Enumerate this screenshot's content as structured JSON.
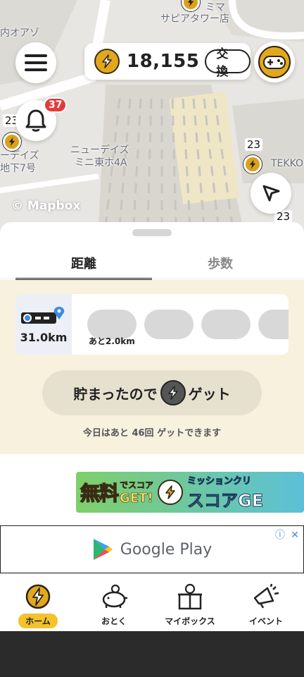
{
  "map": {
    "labels": {
      "mima": "ミマ",
      "sapia": "サピアタワー店",
      "uchioazo": "内オアゾ",
      "newdays1": "ニューデイズ",
      "newdays2": "ミニ東ホ4A",
      "fides": "ーデイズ",
      "chika7": "地下7号",
      "tekko": "TEKKO",
      "num23a": "23",
      "num23b": "23",
      "num23c": "23"
    },
    "attribution": "© Mapbox",
    "notification_count": "37"
  },
  "header": {
    "points": "18,155",
    "exchange_label": "交換"
  },
  "tabs": [
    {
      "label": "距離",
      "active": true
    },
    {
      "label": "歩数",
      "active": false
    }
  ],
  "progress": {
    "distance": "31.0km",
    "remaining": "あと2.0km"
  },
  "get_button": {
    "prefix": "貯まったので",
    "suffix": "ゲット"
  },
  "today_text": "今日はあと 46回 ゲットできます",
  "banner": {
    "main": "無料",
    "sub_top": "でスコア",
    "sub_bottom": "GET!",
    "right_top": "ミッションクリ",
    "right_bottom": "スコアGE"
  },
  "ad": {
    "text": "Google Play",
    "info_icon": "info-icon",
    "close_icon": "close-icon"
  },
  "bottom_nav": [
    {
      "label": "ホーム",
      "icon": "coin-icon",
      "active": true
    },
    {
      "label": "おとく",
      "icon": "piggy-bank-icon",
      "active": false
    },
    {
      "label": "マイボックス",
      "icon": "gift-box-icon",
      "active": false
    },
    {
      "label": "イベント",
      "icon": "megaphone-icon",
      "active": false
    }
  ],
  "colors": {
    "accent": "#f4c22b",
    "coin": "#e2a81d",
    "notification": "#e23b3b",
    "sheet_background": "#f7f1de"
  }
}
